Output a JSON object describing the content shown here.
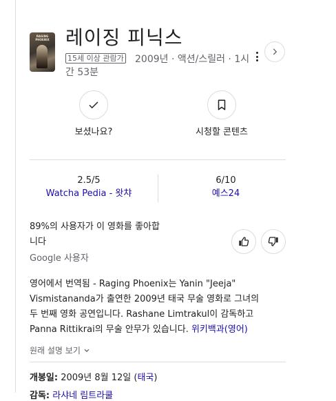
{
  "poster": {
    "text": "RAGING PHOENIX"
  },
  "movie": {
    "title": "레이징 피닉스",
    "age_rating": "15세 이상 관람가",
    "meta_line1": "2009년 · 액션/스릴러 · 1시",
    "meta_line2": "간 53분"
  },
  "actions": {
    "watched_label": "보셨나요?",
    "watchlist_label": "시청할 콘텐츠"
  },
  "scores": [
    {
      "value": "2.5/5",
      "source": "Watcha Pedia - 왓챠"
    },
    {
      "value": "6/10",
      "source": "예스24"
    }
  ],
  "audience": {
    "line1": "89%의 사용자가 이 영화를 좋아합",
    "line2": "니다",
    "source": "Google 사용자"
  },
  "description": {
    "prefix": "영어에서 번역됨 - ",
    "line1": "Raging Phoenix는 Yanin \"Jeeja\"",
    "line2": "Vismistananda가 출연한 2009년 태국 무술 영화로 그녀의",
    "line3": "두 번째 영화 공연입니다. Rashane Limtrakul이 감독하고",
    "line4": "Panna Rittikrai의 무술 안무가 있습니다. ",
    "source_link": "위키백과(영어)"
  },
  "more_link": "원래 설명 보기",
  "facts": {
    "release_label": "개봉일:",
    "release_value": " 2009년 8월 12일 (",
    "release_country": "태국",
    "release_close": ")",
    "director_label": "감독:",
    "director_value": " 라샤네 림트라쿨"
  }
}
